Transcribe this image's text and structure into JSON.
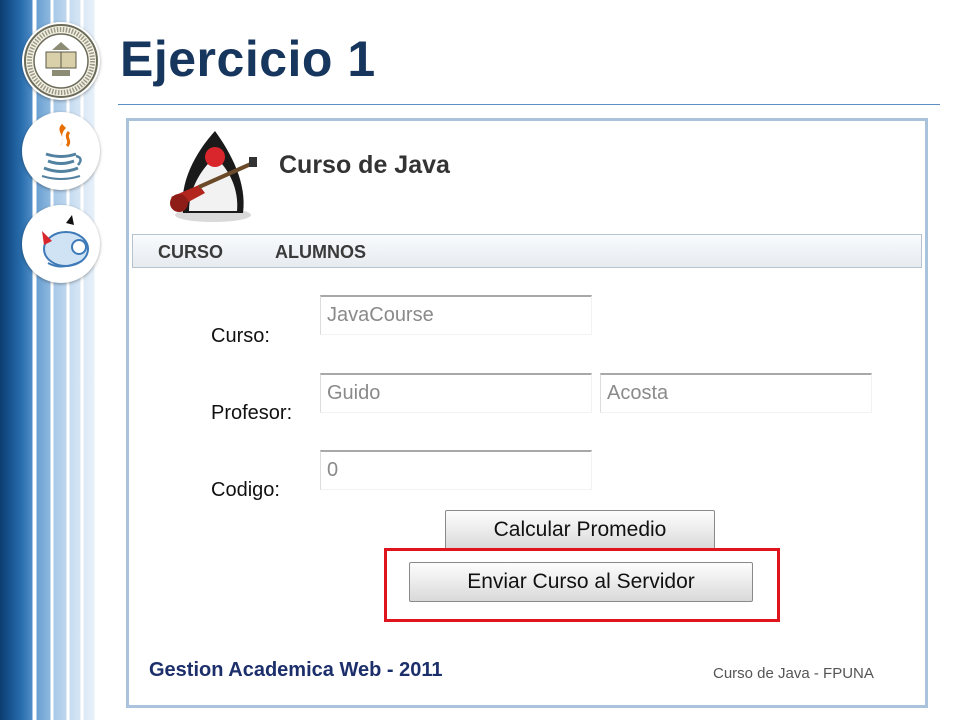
{
  "slide": {
    "title": "Ejercicio 1"
  },
  "logos": {
    "seal": "university-seal-icon",
    "java": "java-cup-icon",
    "duke": "duke-mascot-icon"
  },
  "app": {
    "header_title": "Curso de Java",
    "header_image": "duke-guitar-icon",
    "menu": [
      {
        "label": "CURSO"
      },
      {
        "label": "ALUMNOS"
      }
    ],
    "form": {
      "curso_label": "Curso:",
      "profesor_label": "Profesor:",
      "codigo_label": "Codigo:",
      "curso_value": "JavaCourse",
      "profesor_nombre_value": "Guido",
      "profesor_apellido_value": "Acosta",
      "codigo_value": "0"
    },
    "buttons": {
      "calcular_promedio": "Calcular Promedio",
      "enviar_curso": "Enviar Curso al Servidor"
    },
    "footer": {
      "left": "Gestion Academica Web - 2011",
      "right": "Curso de Java - FPUNA"
    }
  },
  "colors": {
    "title": "#17365d",
    "highlight_border": "#e0141c",
    "footer_text": "#1c2f6b",
    "window_border": "#a9c3dd"
  }
}
